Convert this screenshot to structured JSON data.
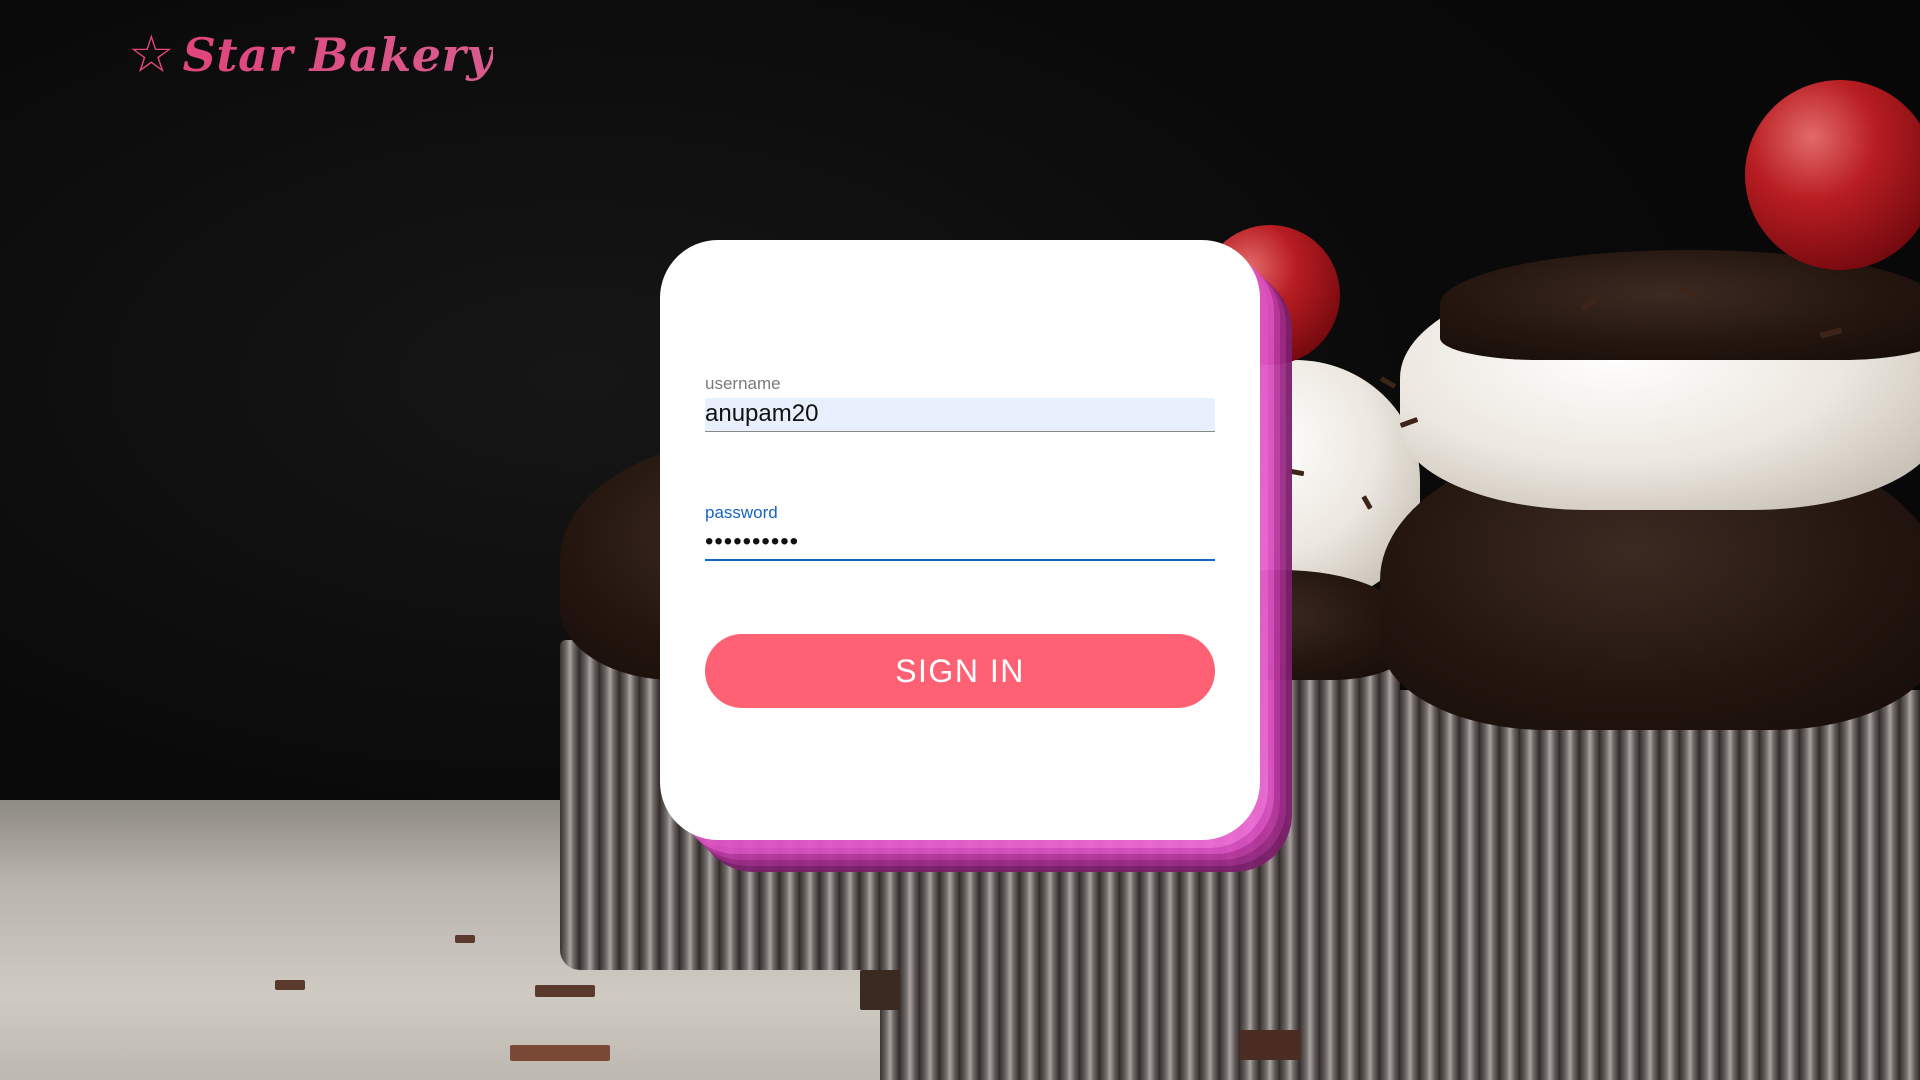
{
  "brand": {
    "logo_icon": "star-icon",
    "logo_glyph": "☆",
    "name": "Star Bakery",
    "color": "#e0457b"
  },
  "login_form": {
    "username": {
      "label": "username",
      "value": "anupam20"
    },
    "password": {
      "label": "password",
      "value": "••••••••••"
    },
    "submit_label": "SIGN IN",
    "submit_color": "#fe6174",
    "focus_color": "#1565c0"
  },
  "card_accent_color": "#e257c8"
}
